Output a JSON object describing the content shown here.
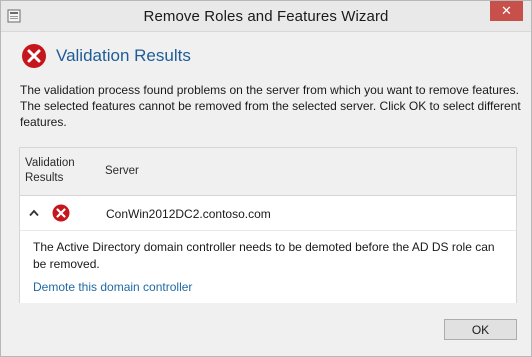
{
  "window": {
    "title": "Remove Roles and Features Wizard",
    "close_glyph": "✕"
  },
  "header": {
    "title": "Validation Results",
    "icon": "error-icon"
  },
  "description": "The validation process found problems on the server from which you want to remove features. The selected features cannot be removed from the selected server.  Click OK to select different features.",
  "results": {
    "columns": {
      "validation": "Validation Results",
      "server": "Server"
    },
    "rows": [
      {
        "server": "ConWin2012DC2.contoso.com",
        "status_icon": "error-icon",
        "expanded": true,
        "message": "The Active Directory domain controller needs to be demoted before the AD DS role can be removed.",
        "link": "Demote this domain controller"
      }
    ]
  },
  "buttons": {
    "ok": "OK"
  },
  "colors": {
    "accent_title": "#1f5c96",
    "link": "#1f6aa5",
    "error": "#c4161c",
    "close_button": "#c7504b"
  }
}
